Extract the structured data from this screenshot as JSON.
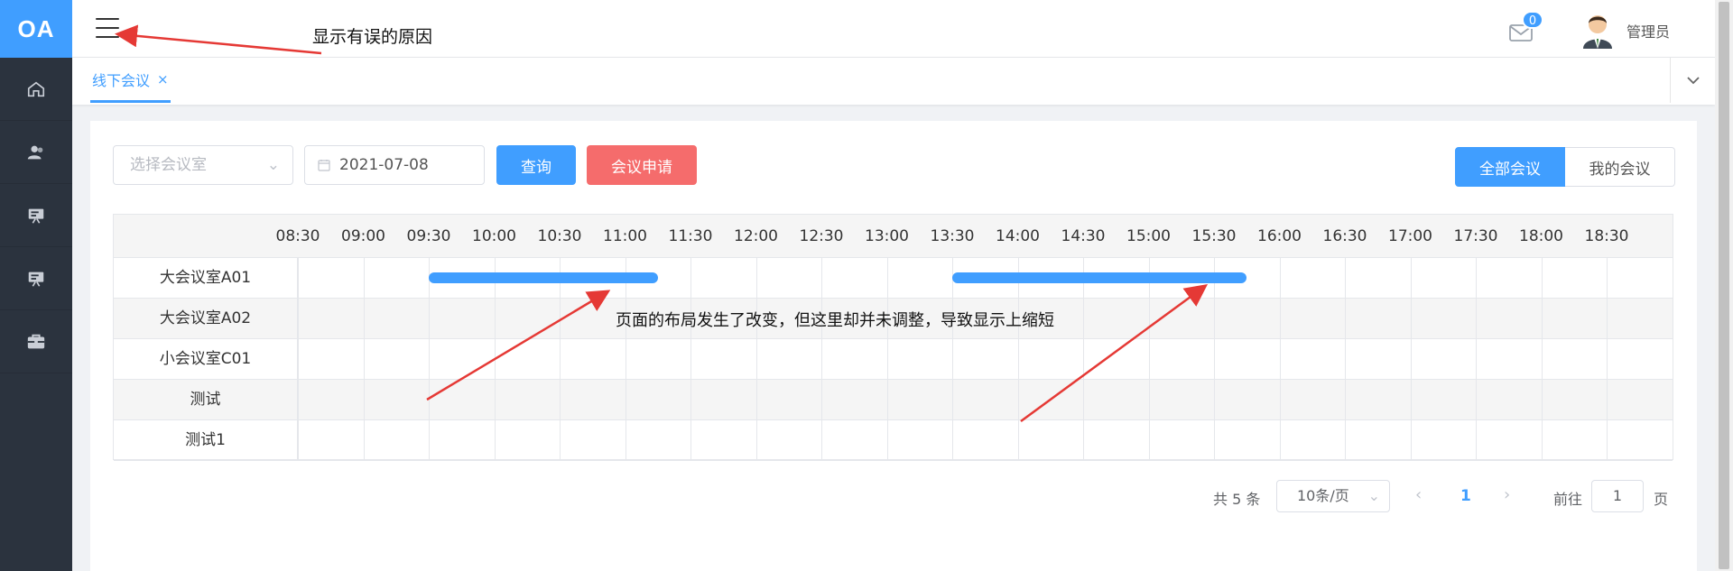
{
  "sidebar": {
    "logo": "OA",
    "items": [
      {
        "icon": "home-icon"
      },
      {
        "icon": "users-icon"
      },
      {
        "icon": "presentation-icon"
      },
      {
        "icon": "presentation-alt-icon"
      },
      {
        "icon": "briefcase-icon"
      }
    ]
  },
  "header": {
    "annotation": "显示有误的原因",
    "mail_badge": "0",
    "username": "管理员"
  },
  "tabs": [
    {
      "label": "线下会议",
      "close": "×"
    }
  ],
  "toolbar": {
    "room_placeholder": "选择会议室",
    "date_value": "2021-07-08",
    "query_label": "查询",
    "apply_label": "会议申请",
    "view_all_label": "全部会议",
    "view_mine_label": "我的会议"
  },
  "schedule": {
    "times": [
      "08:30",
      "09:00",
      "09:30",
      "10:00",
      "10:30",
      "11:00",
      "11:30",
      "12:00",
      "12:30",
      "13:00",
      "13:30",
      "14:00",
      "14:30",
      "15:00",
      "15:30",
      "16:00",
      "16:30",
      "17:00",
      "17:30",
      "18:00",
      "18:30"
    ],
    "rooms": [
      "大会议室A01",
      "大会议室A02",
      "小会议室C01",
      "测试",
      "测试1"
    ],
    "bookings": [
      {
        "room": "大会议室A01",
        "start": "09:00",
        "end": "10:45"
      },
      {
        "room": "大会议室A01",
        "start": "13:00",
        "end": "15:15"
      }
    ],
    "annotation": "页面的布局发生了改变，但这里却并未调整，导致显示上缩短"
  },
  "pagination": {
    "total": "共 5 条",
    "page_size": "10条/页",
    "prev": "‹",
    "current": "1",
    "next": "›",
    "goto_label": "前往",
    "goto_value": "1",
    "goto_unit": "页"
  },
  "colors": {
    "primary": "#409eff",
    "danger": "#f56c6c",
    "sidebar": "#2b333e",
    "annotation_arrow": "#e53935"
  }
}
